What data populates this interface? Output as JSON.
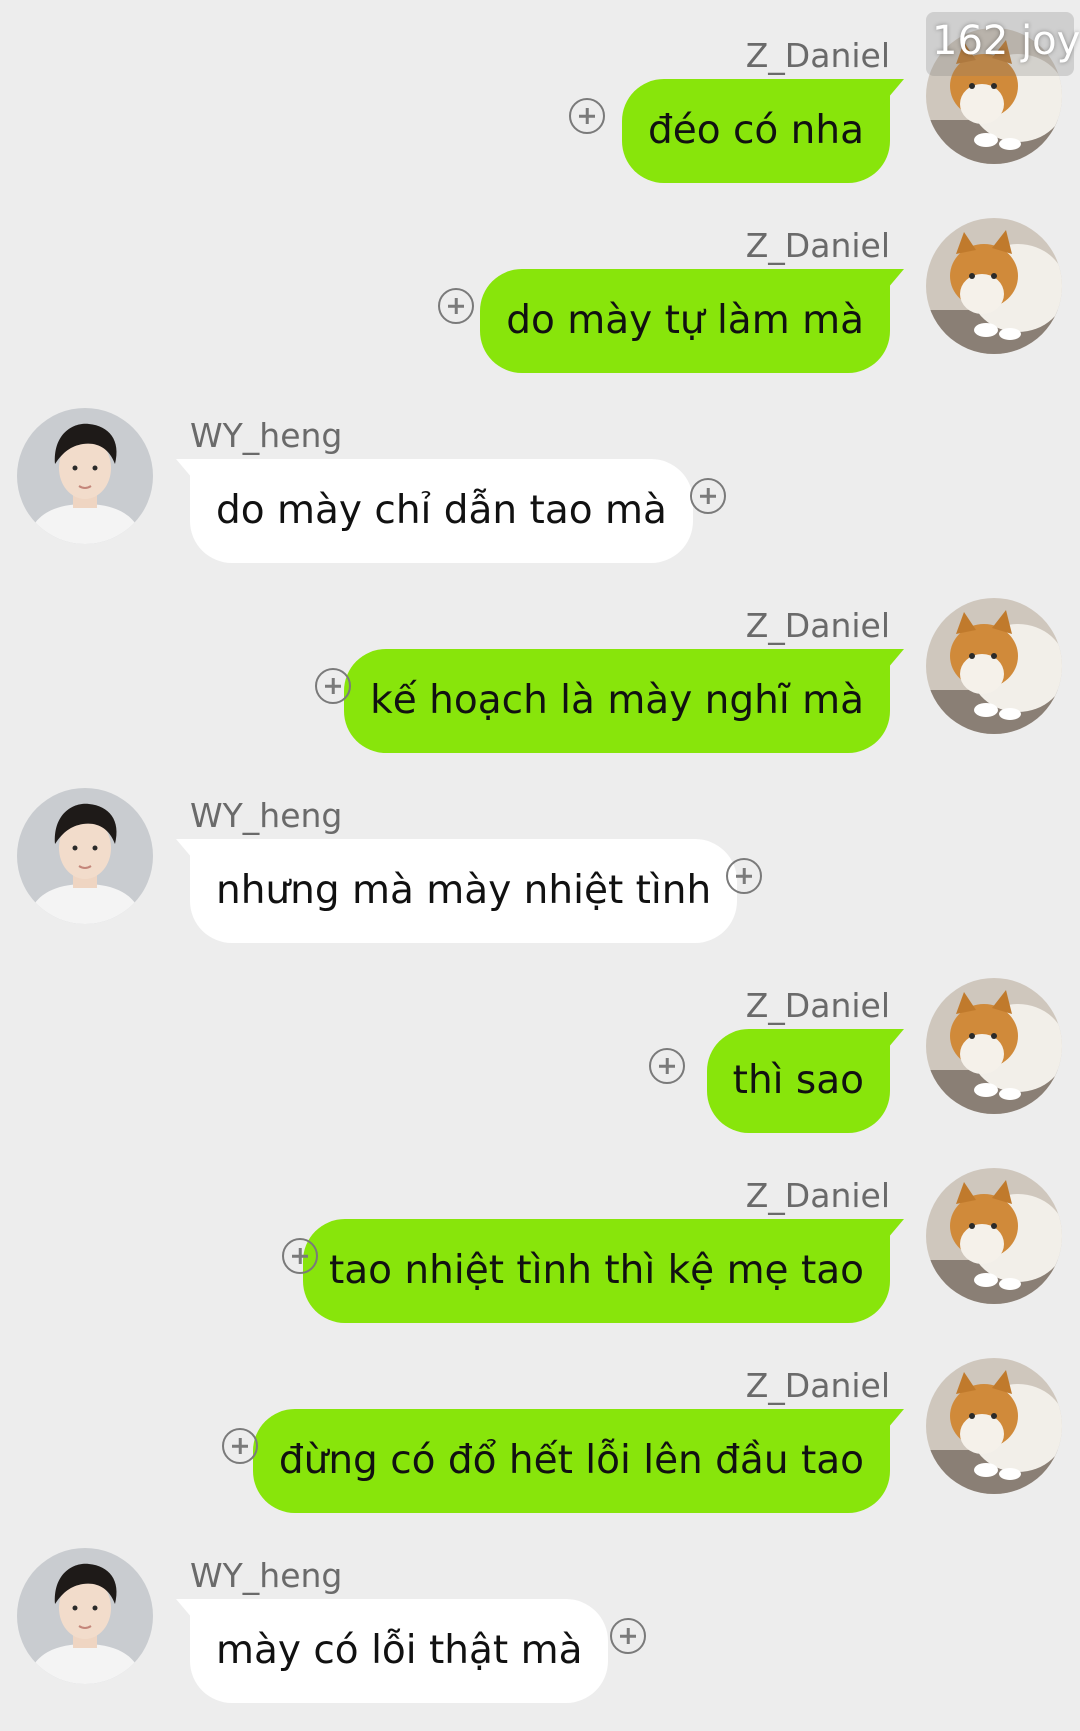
{
  "watermark": "162 joy",
  "colors": {
    "background": "#ededed",
    "outgoing_bubble": "#88e50b",
    "incoming_bubble": "#ffffff",
    "name_text": "#6a6a6a",
    "plus_icon": "#7a7a7a"
  },
  "messages": [
    {
      "sender": "Z_Daniel",
      "text": "đéo có nha",
      "direction": "outgoing",
      "avatar": "cat-avatar"
    },
    {
      "sender": "Z_Daniel",
      "text": "do mày tự làm mà",
      "direction": "outgoing",
      "avatar": "cat-avatar"
    },
    {
      "sender": "WY_heng",
      "text": "do mày chỉ dẫn tao mà",
      "direction": "incoming",
      "avatar": "boy-avatar"
    },
    {
      "sender": "Z_Daniel",
      "text": "kế hoạch là mày nghĩ mà",
      "direction": "outgoing",
      "avatar": "cat-avatar"
    },
    {
      "sender": "WY_heng",
      "text": "nhưng mà mày nhiệt tình",
      "direction": "incoming",
      "avatar": "boy-avatar"
    },
    {
      "sender": "Z_Daniel",
      "text": "thì sao",
      "direction": "outgoing",
      "avatar": "cat-avatar"
    },
    {
      "sender": "Z_Daniel",
      "text": "tao nhiệt tình thì kệ mẹ tao",
      "direction": "outgoing",
      "avatar": "cat-avatar"
    },
    {
      "sender": "Z_Daniel",
      "text": "đừng có đổ hết lỗi lên đầu tao",
      "direction": "outgoing",
      "avatar": "cat-avatar"
    },
    {
      "sender": "WY_heng",
      "text": "mày có lỗi thật mà",
      "direction": "incoming",
      "avatar": "boy-avatar"
    }
  ]
}
